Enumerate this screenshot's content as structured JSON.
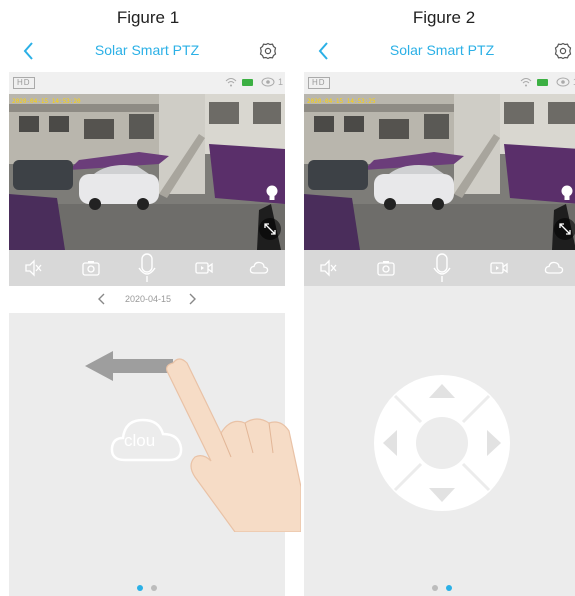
{
  "captions": {
    "figure1": "Figure 1",
    "figure2": "Figure 2"
  },
  "panel": {
    "title": "Solar Smart PTZ",
    "hd_label": "HD",
    "viewer_count": "1",
    "timestamp": "2020-04-15 14:53:20",
    "timestamp2": "2020-04-15 14:53:25",
    "date": "2020-04-15",
    "cloud_label": "clou",
    "accent_color": "#2bb0e6"
  },
  "icons": [
    "back-icon",
    "settings-icon",
    "wifi-icon",
    "battery-icon",
    "eye-icon",
    "bulb-icon",
    "fullscreen-icon",
    "mute-icon",
    "snapshot-icon",
    "microphone-icon",
    "record-icon",
    "cloud-icon",
    "hand-icon",
    "ptz-pad-icon"
  ],
  "pager": {
    "figure1_active": 1,
    "figure2_active": 2,
    "count": 2
  }
}
